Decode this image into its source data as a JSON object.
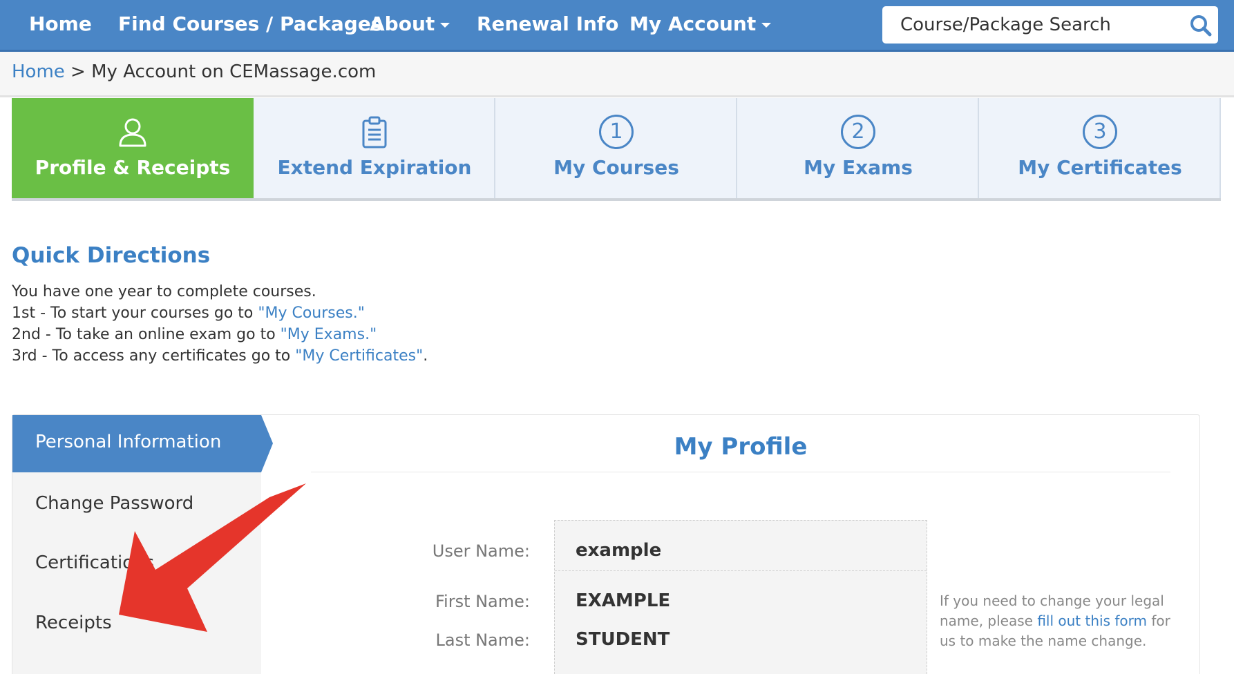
{
  "nav": {
    "home": "Home",
    "find_courses": "Find Courses / Packages",
    "about": "About",
    "renewal_info": "Renewal Info",
    "my_account": "My Account",
    "search_placeholder": "Course/Package Search",
    "search_icon": "search-icon"
  },
  "breadcrumb": {
    "home": "Home",
    "separator": " > ",
    "current": "My Account on CEMassage.com"
  },
  "tabs": [
    {
      "label": "Profile & Receipts",
      "icon": "user-icon",
      "active": true
    },
    {
      "label": "Extend Expiration",
      "icon": "clipboard-icon"
    },
    {
      "label": "My Courses",
      "icon": "step-1-icon",
      "number": "1"
    },
    {
      "label": "My Exams",
      "icon": "step-2-icon",
      "number": "2"
    },
    {
      "label": "My Certificates",
      "icon": "step-3-icon",
      "number": "3"
    }
  ],
  "quick_directions": {
    "title": "Quick Directions",
    "line1": "You have one year to complete courses.",
    "line2_prefix": "1st - To start your courses go to ",
    "line2_link": "\"My Courses.\"",
    "line3_prefix": "2nd - To take an online exam go to ",
    "line3_link": "\"My Exams.\"",
    "line4_prefix": "3rd - To access any certificates go to ",
    "line4_link": "\"My Certificates\"",
    "line4_suffix": "."
  },
  "sidebar": {
    "items": [
      {
        "label": "Personal Information",
        "active": true
      },
      {
        "label": "Change Password"
      },
      {
        "label": "Certifications"
      },
      {
        "label": "Receipts"
      }
    ]
  },
  "profile": {
    "title": "My Profile",
    "fields": [
      {
        "label": "User Name:",
        "value": "example"
      },
      {
        "label": "First Name:",
        "value": "EXAMPLE"
      },
      {
        "label": "Last Name:",
        "value": "STUDENT"
      }
    ],
    "legal_note_prefix": "If you need to change your legal name, please ",
    "legal_note_link": "fill out this form",
    "legal_note_suffix": " for us to make the name change."
  },
  "colors": {
    "nav_blue": "#4a86c6",
    "active_tab_green": "#6abf45",
    "link_blue": "#3b80c4",
    "annotation_red": "#e5352b"
  }
}
